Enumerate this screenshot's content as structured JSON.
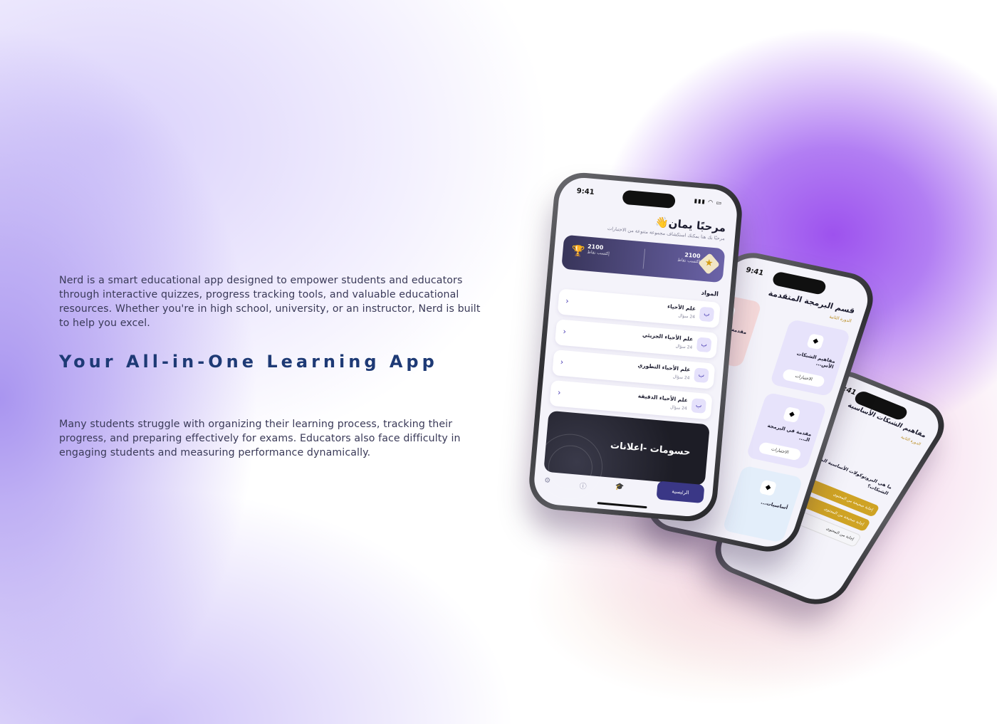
{
  "page": {
    "intro": "Nerd is a smart educational app designed to empower students and educators through interactive quizzes, progress tracking tools, and valuable educational resources. Whether you're in high school, university, or an instructor, Nerd is built to help you excel.",
    "headline": "Your All-in-One Learning App",
    "tagline": "Many students struggle with organizing their learning process, tracking their progress, and preparing effectively for exams. Educators also face difficulty in engaging students and measuring performance dynamically."
  },
  "main_phone": {
    "time": "9:41",
    "greeting": "مرحبًا يمان👋",
    "greeting_sub": "مرحبًا بك هنا يمكنك استكشاف مجموعة متنوعة من الاختبارات",
    "points_left_value": "2100",
    "points_left_label": "إكتسب نقاط",
    "points_right_value": "2100",
    "points_right_label": "إكتسب نقاط",
    "subjects_label": "المواد",
    "subjects": [
      {
        "letter": "ب",
        "name": "علم الأحياء",
        "count": "24 سؤال"
      },
      {
        "letter": "ب",
        "name": "علم الأحياء الجزيئي",
        "count": "24 سؤال"
      },
      {
        "letter": "ب",
        "name": "علم الأحياء التطوري",
        "count": "24 سؤال"
      },
      {
        "letter": "ب",
        "name": "علم الأحياء الدقيقة",
        "count": "24 سؤال"
      }
    ],
    "promo": "حسومات -اعلانات",
    "nav_home": "الرئيسية"
  },
  "mid_phone": {
    "time": "9:41",
    "title": "قسم البرمجة المتقدمة",
    "subtitle": "الدورة الثانية",
    "tiles": [
      {
        "name": "مفاهيم الشبكات الأس...",
        "button": "الاختبارات"
      },
      {
        "name": "مقدمة في ع...",
        "button": ""
      },
      {
        "name": "مقدمة في البرمجة الـ...",
        "button": "الاختبارات"
      },
      {
        "name": "أساسيات...",
        "button": ""
      }
    ]
  },
  "back_phone": {
    "time": "9:41",
    "title": "مفاهيم الشبكات الأساسية",
    "subtitle": "الدورة الثانية",
    "question": "ما هي البروتوكولات الأساسية المستخدمة في الشبكات؟",
    "answers": [
      "إجابة صحيحة من المحتوى",
      "إجابة صحيحة من المحتوى",
      "إجابة من المحتوى"
    ]
  }
}
